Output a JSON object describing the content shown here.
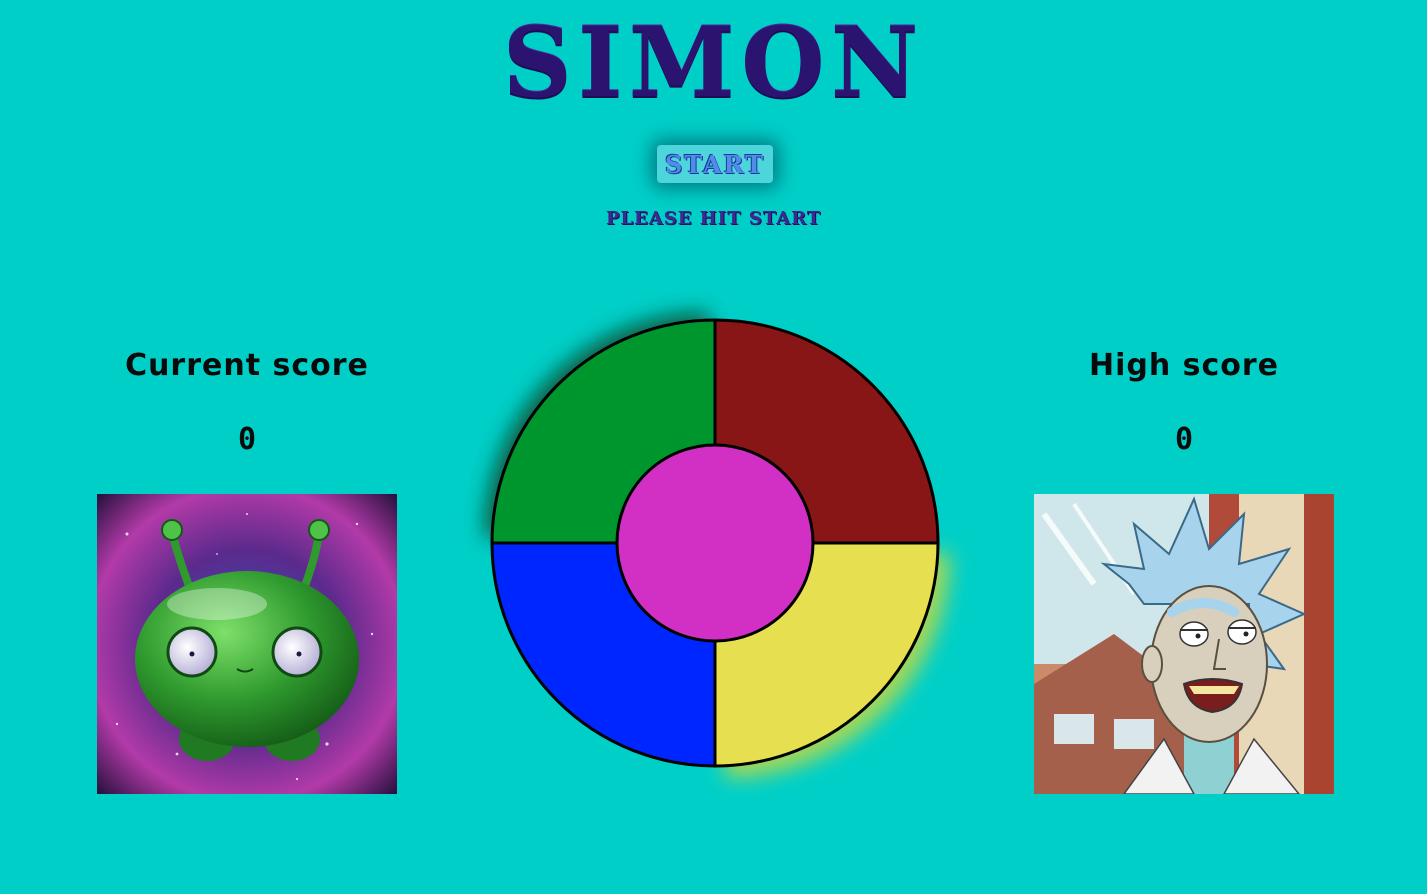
{
  "game": {
    "title": "SIMON",
    "start_label": "START",
    "status": "PLEASE HIT START"
  },
  "scores": {
    "current_label": "Current score",
    "current_value": "0",
    "high_label": "High score",
    "high_value": "0"
  },
  "colors": {
    "background": "#00cfc8",
    "green_pad": "#00962e",
    "red_pad": "#881616",
    "yellow_pad": "#e6df4f",
    "blue_pad": "#0026ff",
    "center": "#d22fc4",
    "title": "#2b1470"
  },
  "images": {
    "left_avatar": "green-alien-character",
    "right_avatar": "scientist-cartoon-character"
  }
}
